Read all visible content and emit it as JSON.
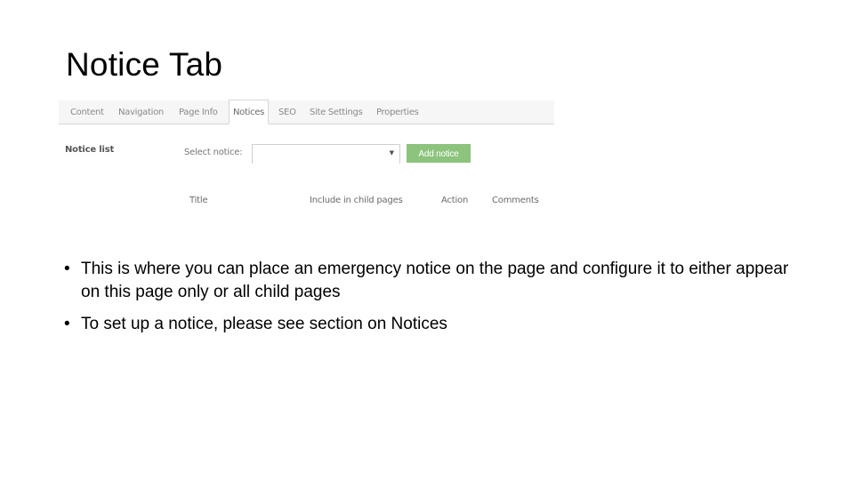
{
  "slide": {
    "title": "Notice Tab"
  },
  "tabs": [
    {
      "label": "Content",
      "active": false
    },
    {
      "label": "Navigation",
      "active": false
    },
    {
      "label": "Page Info",
      "active": false
    },
    {
      "label": "Notices",
      "active": true
    },
    {
      "label": "SEO",
      "active": false
    },
    {
      "label": "Site Settings",
      "active": false
    },
    {
      "label": "Properties",
      "active": false
    }
  ],
  "notice_panel": {
    "section_label": "Notice list",
    "select_label": "Select notice:",
    "select_value": "",
    "select_arrow_icon": "triangle-down",
    "add_button_label": "Add notice",
    "add_button_color": "#8cc47e",
    "columns": [
      "Title",
      "Include in child pages",
      "Action",
      "Comments"
    ]
  },
  "bullets": {
    "bullet_glyph": "•",
    "items": [
      "This is where you can place an emergency notice on the page and configure it to either appear on this page only or all child pages",
      "To set up a notice, please see section on Notices"
    ]
  }
}
